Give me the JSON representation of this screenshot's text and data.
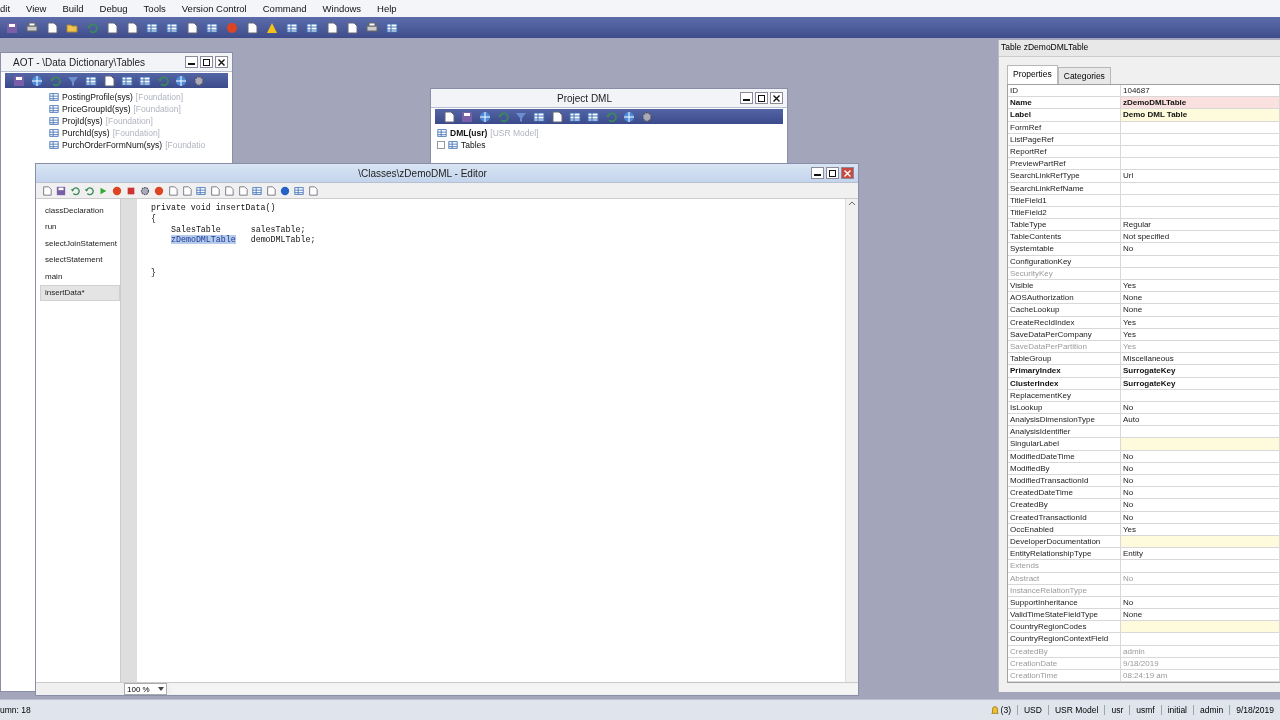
{
  "menu": [
    "dit",
    "View",
    "Build",
    "Debug",
    "Tools",
    "Version Control",
    "Command",
    "Windows",
    "Help"
  ],
  "aot_window": {
    "title": "AOT - \\Data Dictionary\\Tables",
    "active": false,
    "items": [
      {
        "name": "PostingProfile(sys)",
        "layer": "[Foundation]"
      },
      {
        "name": "PriceGroupId(sys)",
        "layer": "[Foundation]"
      },
      {
        "name": "ProjId(sys)",
        "layer": "[Foundation]"
      },
      {
        "name": "PurchId(sys)",
        "layer": "[Foundation]"
      },
      {
        "name": "PurchOrderFormNum(sys)",
        "layer": "[Foundatio"
      }
    ]
  },
  "project_window": {
    "title": "Project DML",
    "active": false,
    "items": [
      {
        "kind": "project",
        "name": "DML(usr)",
        "layer": "[USR Model]"
      },
      {
        "kind": "folder",
        "name": "Tables"
      }
    ]
  },
  "editor": {
    "title": "\\Classes\\zDemoDML - Editor",
    "active": true,
    "methods": [
      {
        "label": "classDeclaration",
        "selected": false
      },
      {
        "label": "run",
        "selected": false
      },
      {
        "label": "selectJoinStatement",
        "selected": false
      },
      {
        "label": "selectStatement",
        "selected": false
      },
      {
        "label": "main",
        "selected": false
      },
      {
        "label": "insertData*",
        "selected": true
      }
    ],
    "code": [
      {
        "kind": "code",
        "segments": [
          {
            "text": "private void insertData()",
            "selected": false
          }
        ]
      },
      {
        "kind": "code",
        "segments": [
          {
            "text": "{",
            "selected": false
          }
        ]
      },
      {
        "kind": "indented",
        "segments": [
          {
            "text": "SalesTable      salesTable;",
            "selected": false
          }
        ]
      },
      {
        "kind": "indented",
        "segments": [
          {
            "text": "zDemoDMLTable",
            "selected": true
          },
          {
            "text": "   demoDMLTable;",
            "selected": false
          }
        ]
      },
      {
        "kind": "blank"
      },
      {
        "kind": "blank"
      },
      {
        "kind": "code",
        "segments": [
          {
            "text": "}",
            "selected": false
          }
        ]
      }
    ],
    "zoom": "100 %"
  },
  "properties": {
    "title": "Table zDemoDMLTable",
    "tabs": [
      {
        "label": "Properties",
        "selected": true
      },
      {
        "label": "Categories",
        "selected": false
      }
    ],
    "rows": [
      {
        "name": "ID",
        "value": "104687",
        "kind": "normal"
      },
      {
        "name": "Name",
        "value": "zDemoDMLTable",
        "kind": "bold",
        "color": "#fbe0e0"
      },
      {
        "name": "Label",
        "value": "Demo DML Table",
        "kind": "bold",
        "color": "#fdfbdc"
      },
      {
        "name": "FormRef",
        "kind": "normal"
      },
      {
        "name": "ListPageRef",
        "kind": "normal"
      },
      {
        "name": "ReportRef",
        "kind": "normal"
      },
      {
        "name": "PreviewPartRef",
        "kind": "normal"
      },
      {
        "name": "SearchLinkRefType",
        "value": "Url",
        "kind": "normal"
      },
      {
        "name": "SearchLinkRefName",
        "kind": "normal"
      },
      {
        "name": "TitleField1",
        "kind": "normal"
      },
      {
        "name": "TitleField2",
        "kind": "normal"
      },
      {
        "name": "TableType",
        "value": "Regular",
        "kind": "normal"
      },
      {
        "name": "TableContents",
        "value": "Not specified",
        "kind": "normal"
      },
      {
        "name": "Systemtable",
        "value": "No",
        "kind": "normal"
      },
      {
        "name": "ConfigurationKey",
        "kind": "normal"
      },
      {
        "name": "SecurityKey",
        "kind": "dim"
      },
      {
        "name": "Visible",
        "value": "Yes",
        "kind": "normal"
      },
      {
        "name": "AOSAuthorization",
        "value": "None",
        "kind": "normal"
      },
      {
        "name": "CacheLookup",
        "value": "None",
        "kind": "normal"
      },
      {
        "name": "CreateRecIdIndex",
        "value": "Yes",
        "kind": "normal"
      },
      {
        "name": "SaveDataPerCompany",
        "value": "Yes",
        "kind": "normal"
      },
      {
        "name": "SaveDataPerPartition",
        "value": "Yes",
        "kind": "dim"
      },
      {
        "name": "TableGroup",
        "value": "Miscellaneous",
        "kind": "normal"
      },
      {
        "name": "PrimaryIndex",
        "value": "SurrogateKey",
        "kind": "bold"
      },
      {
        "name": "ClusterIndex",
        "value": "SurrogateKey",
        "kind": "bold"
      },
      {
        "name": "ReplacementKey",
        "kind": "normal"
      },
      {
        "name": "IsLookup",
        "value": "No",
        "kind": "normal"
      },
      {
        "name": "AnalysisDimensionType",
        "value": "Auto",
        "kind": "normal"
      },
      {
        "name": "AnalysisIdentifier",
        "kind": "normal"
      },
      {
        "name": "SingularLabel",
        "kind": "normal",
        "color": "#fdfbdc"
      },
      {
        "name": "ModifiedDateTime",
        "value": "No",
        "kind": "normal"
      },
      {
        "name": "ModifiedBy",
        "value": "No",
        "kind": "normal"
      },
      {
        "name": "ModifiedTransactionId",
        "value": "No",
        "kind": "normal"
      },
      {
        "name": "CreatedDateTime",
        "value": "No",
        "kind": "normal"
      },
      {
        "name": "CreatedBy",
        "value": "No",
        "kind": "normal"
      },
      {
        "name": "CreatedTransactionId",
        "value": "No",
        "kind": "normal"
      },
      {
        "name": "OccEnabled",
        "value": "Yes",
        "kind": "normal"
      },
      {
        "name": "DeveloperDocumentation",
        "kind": "normal",
        "color": "#fdfbdc"
      },
      {
        "name": "EntityRelationshipType",
        "value": "Entity",
        "kind": "normal"
      },
      {
        "name": "Extends",
        "kind": "dim"
      },
      {
        "name": "Abstract",
        "value": "No",
        "kind": "dim"
      },
      {
        "name": "InstanceRelationType",
        "kind": "dim"
      },
      {
        "name": "SupportInheritance",
        "value": "No",
        "kind": "normal"
      },
      {
        "name": "ValidTimeStateFieldType",
        "value": "None",
        "kind": "normal"
      },
      {
        "name": "CountryRegionCodes",
        "kind": "normal",
        "color": "#fdfbdc"
      },
      {
        "name": "CountryRegionContextField",
        "kind": "normal"
      },
      {
        "name": "CreatedBy",
        "value": "admin",
        "kind": "dim"
      },
      {
        "name": "CreationDate",
        "value": "9/18/2019",
        "kind": "dim"
      },
      {
        "name": "CreationTime",
        "value": "08:24:19 am",
        "kind": "dim"
      }
    ]
  },
  "status_bar": {
    "position": "umn: 18",
    "notifications": "(3)",
    "fields": [
      "USD",
      "USR Model",
      "usr",
      "usmf",
      "initial",
      "admin",
      "9/18/2019"
    ]
  }
}
